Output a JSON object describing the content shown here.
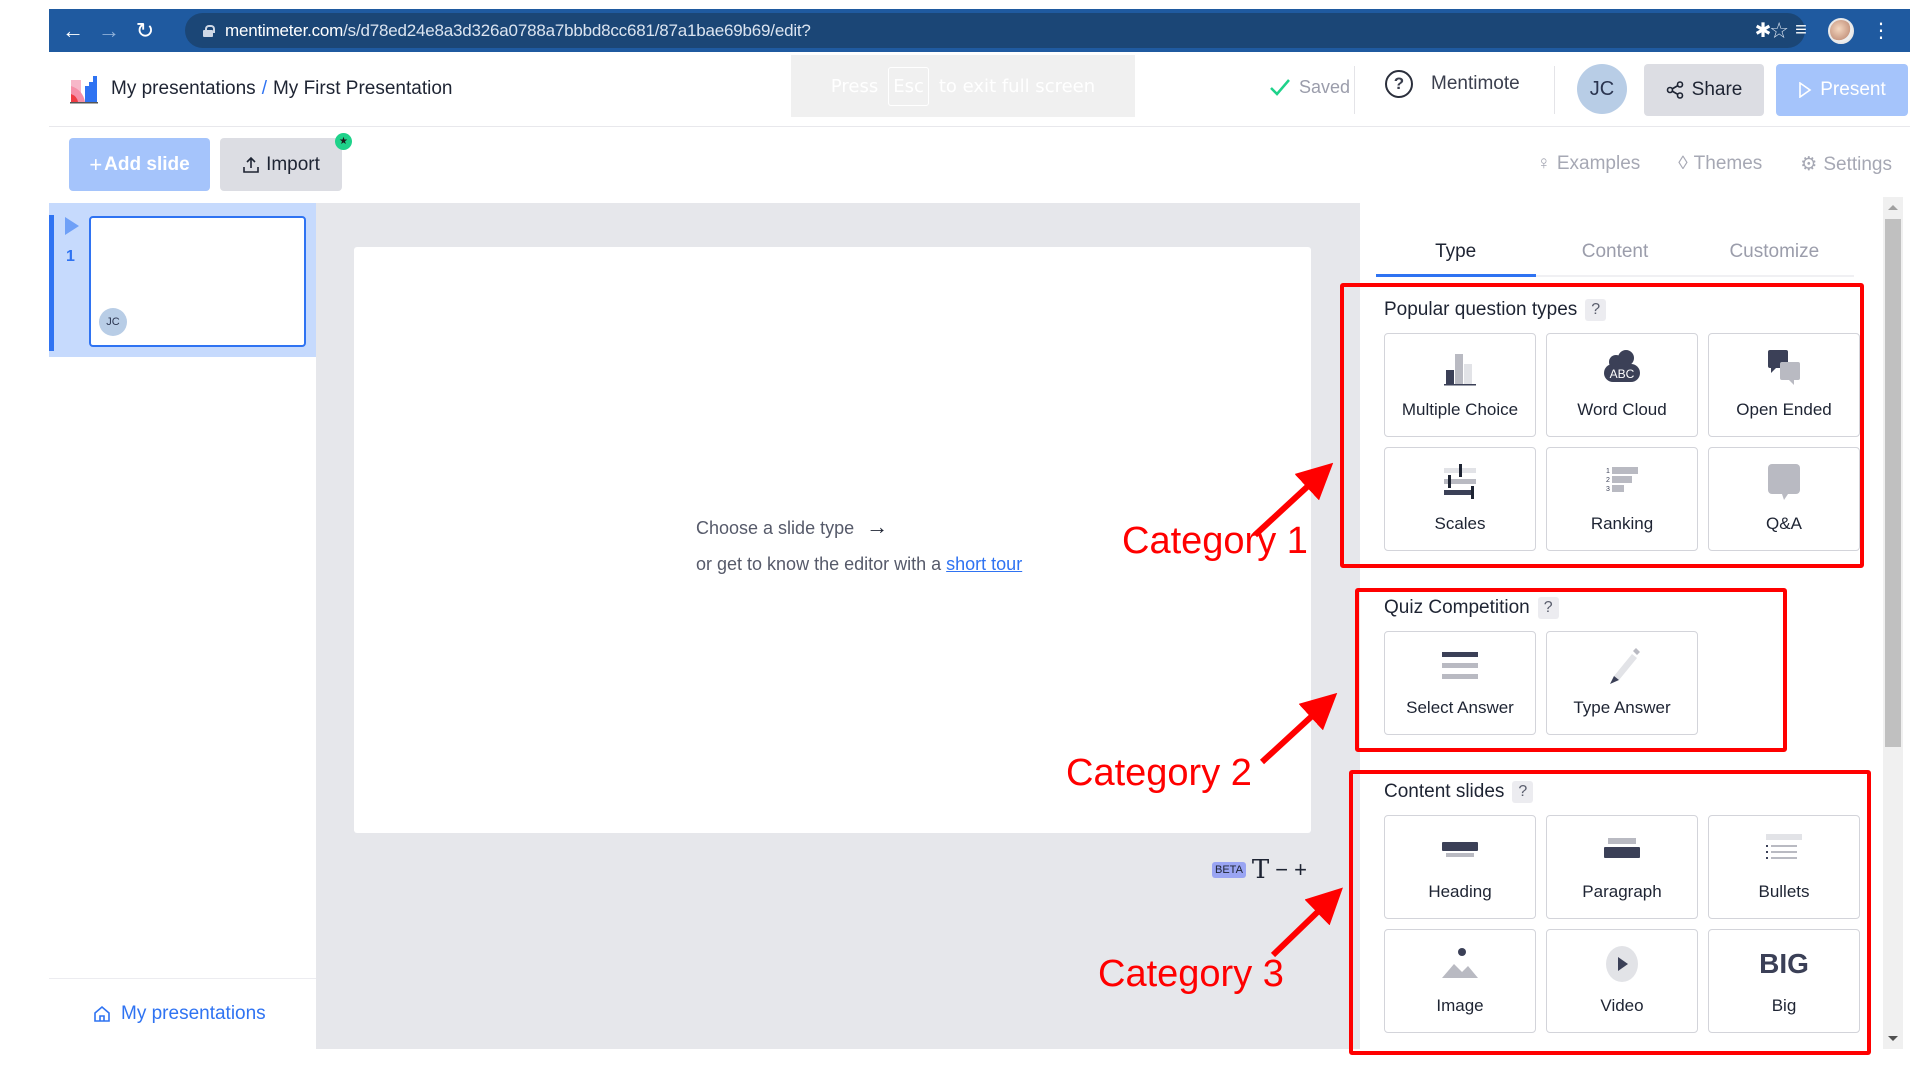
{
  "browser": {
    "url_host": "mentimeter.com",
    "url_path": "/s/d78ed24e8a3d326a0788a7bbbd8cc681/87a1bae69b69/edit?",
    "icons": [
      "back-icon",
      "forward-icon",
      "reload-icon",
      "lock-icon",
      "bookmark-star-icon",
      "extensions-icon",
      "media-queue-icon",
      "profile-avatar",
      "kebab-menu-icon"
    ]
  },
  "header": {
    "breadcrumb_root": "My presentations",
    "breadcrumb_separator": "/",
    "breadcrumb_current": "My First Presentation",
    "fullscreen_toast": {
      "prefix": "Press",
      "key": "Esc",
      "suffix": "to exit full screen"
    },
    "saved_status": "Saved",
    "help_label": "Mentimote",
    "user_initials": "JC",
    "share_label": "Share",
    "present_label": "Present"
  },
  "toolbar": {
    "add_slide_label": "Add slide",
    "add_slide_icon": "+",
    "import_label": "Import",
    "links": [
      {
        "label": "Examples",
        "icon": "lightbulb-icon"
      },
      {
        "label": "Themes",
        "icon": "droplet-icon"
      },
      {
        "label": "Settings",
        "icon": "gear-icon"
      }
    ]
  },
  "sidebar": {
    "slides": [
      {
        "number": "1",
        "avatar": "JC",
        "active": true
      }
    ],
    "footer_link": "My presentations"
  },
  "canvas": {
    "prompt_line1": "Choose a slide type",
    "prompt_line2_prefix": "or get to know the editor with a",
    "prompt_link": "short tour",
    "beta_badge": "BETA",
    "text_size_icon": "T",
    "decrease": "−",
    "increase": "+"
  },
  "right_panel": {
    "tabs": [
      {
        "label": "Type",
        "active": true
      },
      {
        "label": "Content",
        "active": false
      },
      {
        "label": "Customize",
        "active": false
      }
    ],
    "sections": [
      {
        "title": "Popular question types",
        "help": "?",
        "items": [
          {
            "label": "Multiple Choice",
            "icon": "bar-chart-icon"
          },
          {
            "label": "Word Cloud",
            "icon": "word-cloud-icon"
          },
          {
            "label": "Open Ended",
            "icon": "speech-bubbles-icon"
          },
          {
            "label": "Scales",
            "icon": "sliders-icon"
          },
          {
            "label": "Ranking",
            "icon": "ranking-icon"
          },
          {
            "label": "Q&A",
            "icon": "question-bubble-icon"
          }
        ]
      },
      {
        "title": "Quiz Competition",
        "help": "?",
        "items": [
          {
            "label": "Select Answer",
            "icon": "select-list-icon"
          },
          {
            "label": "Type Answer",
            "icon": "pencil-icon"
          }
        ]
      },
      {
        "title": "Content slides",
        "help": "?",
        "items": [
          {
            "label": "Heading",
            "icon": "heading-icon"
          },
          {
            "label": "Paragraph",
            "icon": "paragraph-icon"
          },
          {
            "label": "Bullets",
            "icon": "bullets-icon"
          },
          {
            "label": "Image",
            "icon": "image-icon"
          },
          {
            "label": "Video",
            "icon": "video-play-icon"
          },
          {
            "label": "Big",
            "icon": "big-text-icon",
            "glyph": "BIG"
          }
        ]
      }
    ]
  },
  "annotations": [
    {
      "label": "Category 1",
      "color": "#ff0000"
    },
    {
      "label": "Category 2",
      "color": "#ff0000"
    },
    {
      "label": "Category 3",
      "color": "#ff0000"
    }
  ],
  "colors": {
    "brand_blue": "#2f73f2",
    "browser_bar": "#1f5aa0",
    "present_button": "#a5c4fb",
    "saved_check": "#1ed28a",
    "annotation_red": "#ff0000"
  }
}
